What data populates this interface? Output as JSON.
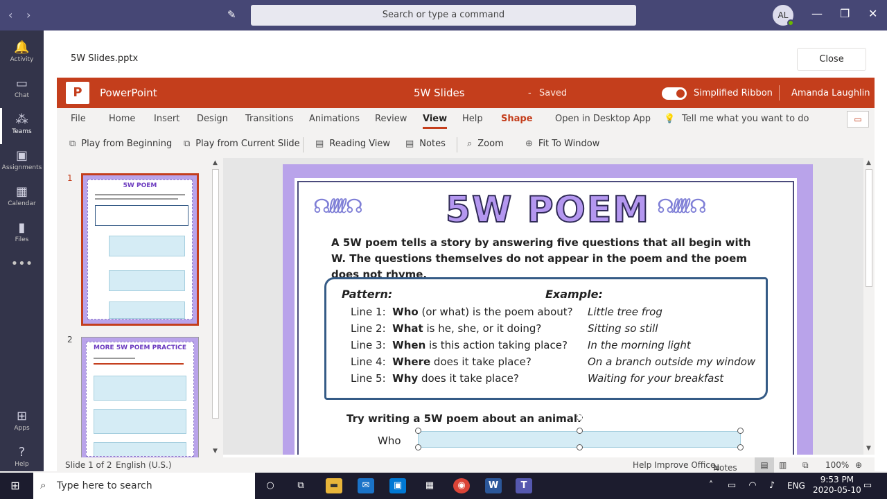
{
  "titlebar": {
    "search_placeholder": "Search or type a command",
    "avatar": "AL"
  },
  "rail": [
    {
      "label": "Activity",
      "icon": "bell-icon"
    },
    {
      "label": "Chat",
      "icon": "chat-icon"
    },
    {
      "label": "Teams",
      "icon": "teams-icon"
    },
    {
      "label": "Assignments",
      "icon": "assignments-icon"
    },
    {
      "label": "Calendar",
      "icon": "calendar-icon"
    },
    {
      "label": "Files",
      "icon": "files-icon"
    },
    {
      "label": "Apps",
      "icon": "apps-icon"
    },
    {
      "label": "Help",
      "icon": "help-icon"
    }
  ],
  "file": {
    "name": "5W Slides.pptx",
    "close": "Close"
  },
  "ppt": {
    "app": "PowerPoint",
    "doc": "5W Slides",
    "dash": "-",
    "saved": "Saved",
    "simplified": "Simplified Ribbon",
    "user": "Amanda Laughlin"
  },
  "tabs": [
    "File",
    "Home",
    "Insert",
    "Design",
    "Transitions",
    "Animations",
    "Review",
    "View",
    "Help",
    "Shape",
    "Open in Desktop App",
    "Tell me what you want to do"
  ],
  "ribbon": [
    "Play from Beginning",
    "Play from Current Slide",
    "Reading View",
    "Notes",
    "Zoom",
    "Fit To Window"
  ],
  "thumbs": {
    "n1": "1",
    "n2": "2",
    "t1": "5W POEM",
    "t2": "MORE 5W POEM PRACTICE"
  },
  "slide": {
    "title": "5W POEM",
    "intro": "A 5W poem tells a story by answering five questions that all begin with W. The questions themselves do not appear in the poem and the poem does not rhyme.",
    "pattern_h": "Pattern:",
    "example_h": "Example:",
    "lines": [
      {
        "n": "Line 1:",
        "w": "Who",
        "rest": "(or what) is the poem about?",
        "ex": "Little tree frog"
      },
      {
        "n": "Line 2:",
        "w": "What",
        "rest": "is he, she, or it doing?",
        "ex": "Sitting so still"
      },
      {
        "n": "Line 3:",
        "w": "When",
        "rest": "is this action taking place?",
        "ex": "In the morning light"
      },
      {
        "n": "Line 4:",
        "w": "Where",
        "rest": "does it take place?",
        "ex": "On a branch outside my window"
      },
      {
        "n": "Line 5:",
        "w": "Why",
        "rest": "does it take place?",
        "ex": "Waiting for your breakfast"
      }
    ],
    "try": "Try writing a 5W poem about an animal.",
    "who": "Who"
  },
  "status": {
    "slide": "Slide 1 of 2",
    "lang": "English (U.S.)",
    "help": "Help Improve Office",
    "notes": "Notes",
    "zoom": "100%"
  },
  "taskbar": {
    "search": "Type here to search",
    "lang": "ENG",
    "time": "9:53 PM",
    "date": "2020-05-10"
  }
}
